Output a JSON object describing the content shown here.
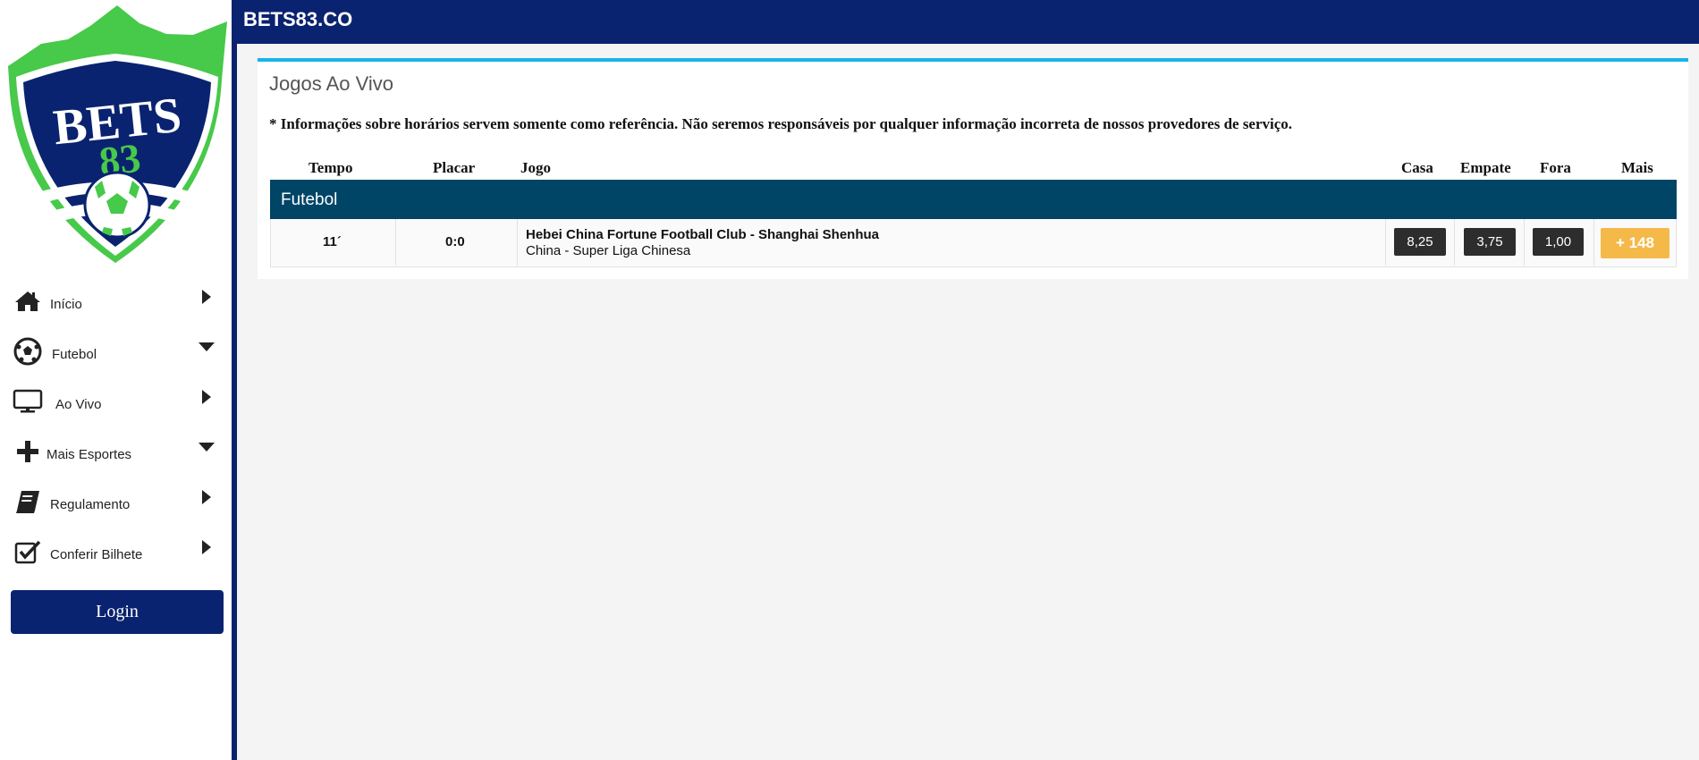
{
  "app": {
    "brand": "BETS83.CO",
    "logo_text": "BETS 83"
  },
  "sidebar": {
    "items": [
      {
        "label": "Início",
        "icon": "home-icon",
        "caret": "right"
      },
      {
        "label": "Futebol",
        "icon": "soccer-ball-icon",
        "caret": "down"
      },
      {
        "label": "Ao Vivo",
        "icon": "monitor-icon",
        "caret": "right"
      },
      {
        "label": "Mais Esportes",
        "icon": "plus-icon",
        "caret": "down"
      },
      {
        "label": "Regulamento",
        "icon": "book-icon",
        "caret": "right"
      },
      {
        "label": "Conferir Bilhete",
        "icon": "check-square-icon",
        "caret": "right"
      }
    ],
    "login_label": "Login"
  },
  "main": {
    "title": "Jogos Ao Vivo",
    "notice": "* Informações sobre horários servem somente como referência. Não seremos responsáveis por qualquer informação incorreta de nossos provedores de serviço.",
    "columns": {
      "tempo": "Tempo",
      "placar": "Placar",
      "jogo": "Jogo",
      "casa": "Casa",
      "empate": "Empate",
      "fora": "Fora",
      "mais": "Mais"
    },
    "group": "Futebol",
    "matches": [
      {
        "tempo": "11´",
        "placar": "0:0",
        "teams": "Hebei China Fortune Football Club - Shanghai Shenhua",
        "league": "China - Super Liga Chinesa",
        "casa": "8,25",
        "empate": "3,75",
        "fora": "1,00",
        "mais": "+ 148"
      }
    ]
  },
  "colors": {
    "navy": "#0a2370",
    "accent": "#18b4ea",
    "group_header": "#004566",
    "odd_bg": "#2d2d2d",
    "more_bg": "#f5b94a",
    "logo_green": "#47c94a"
  }
}
